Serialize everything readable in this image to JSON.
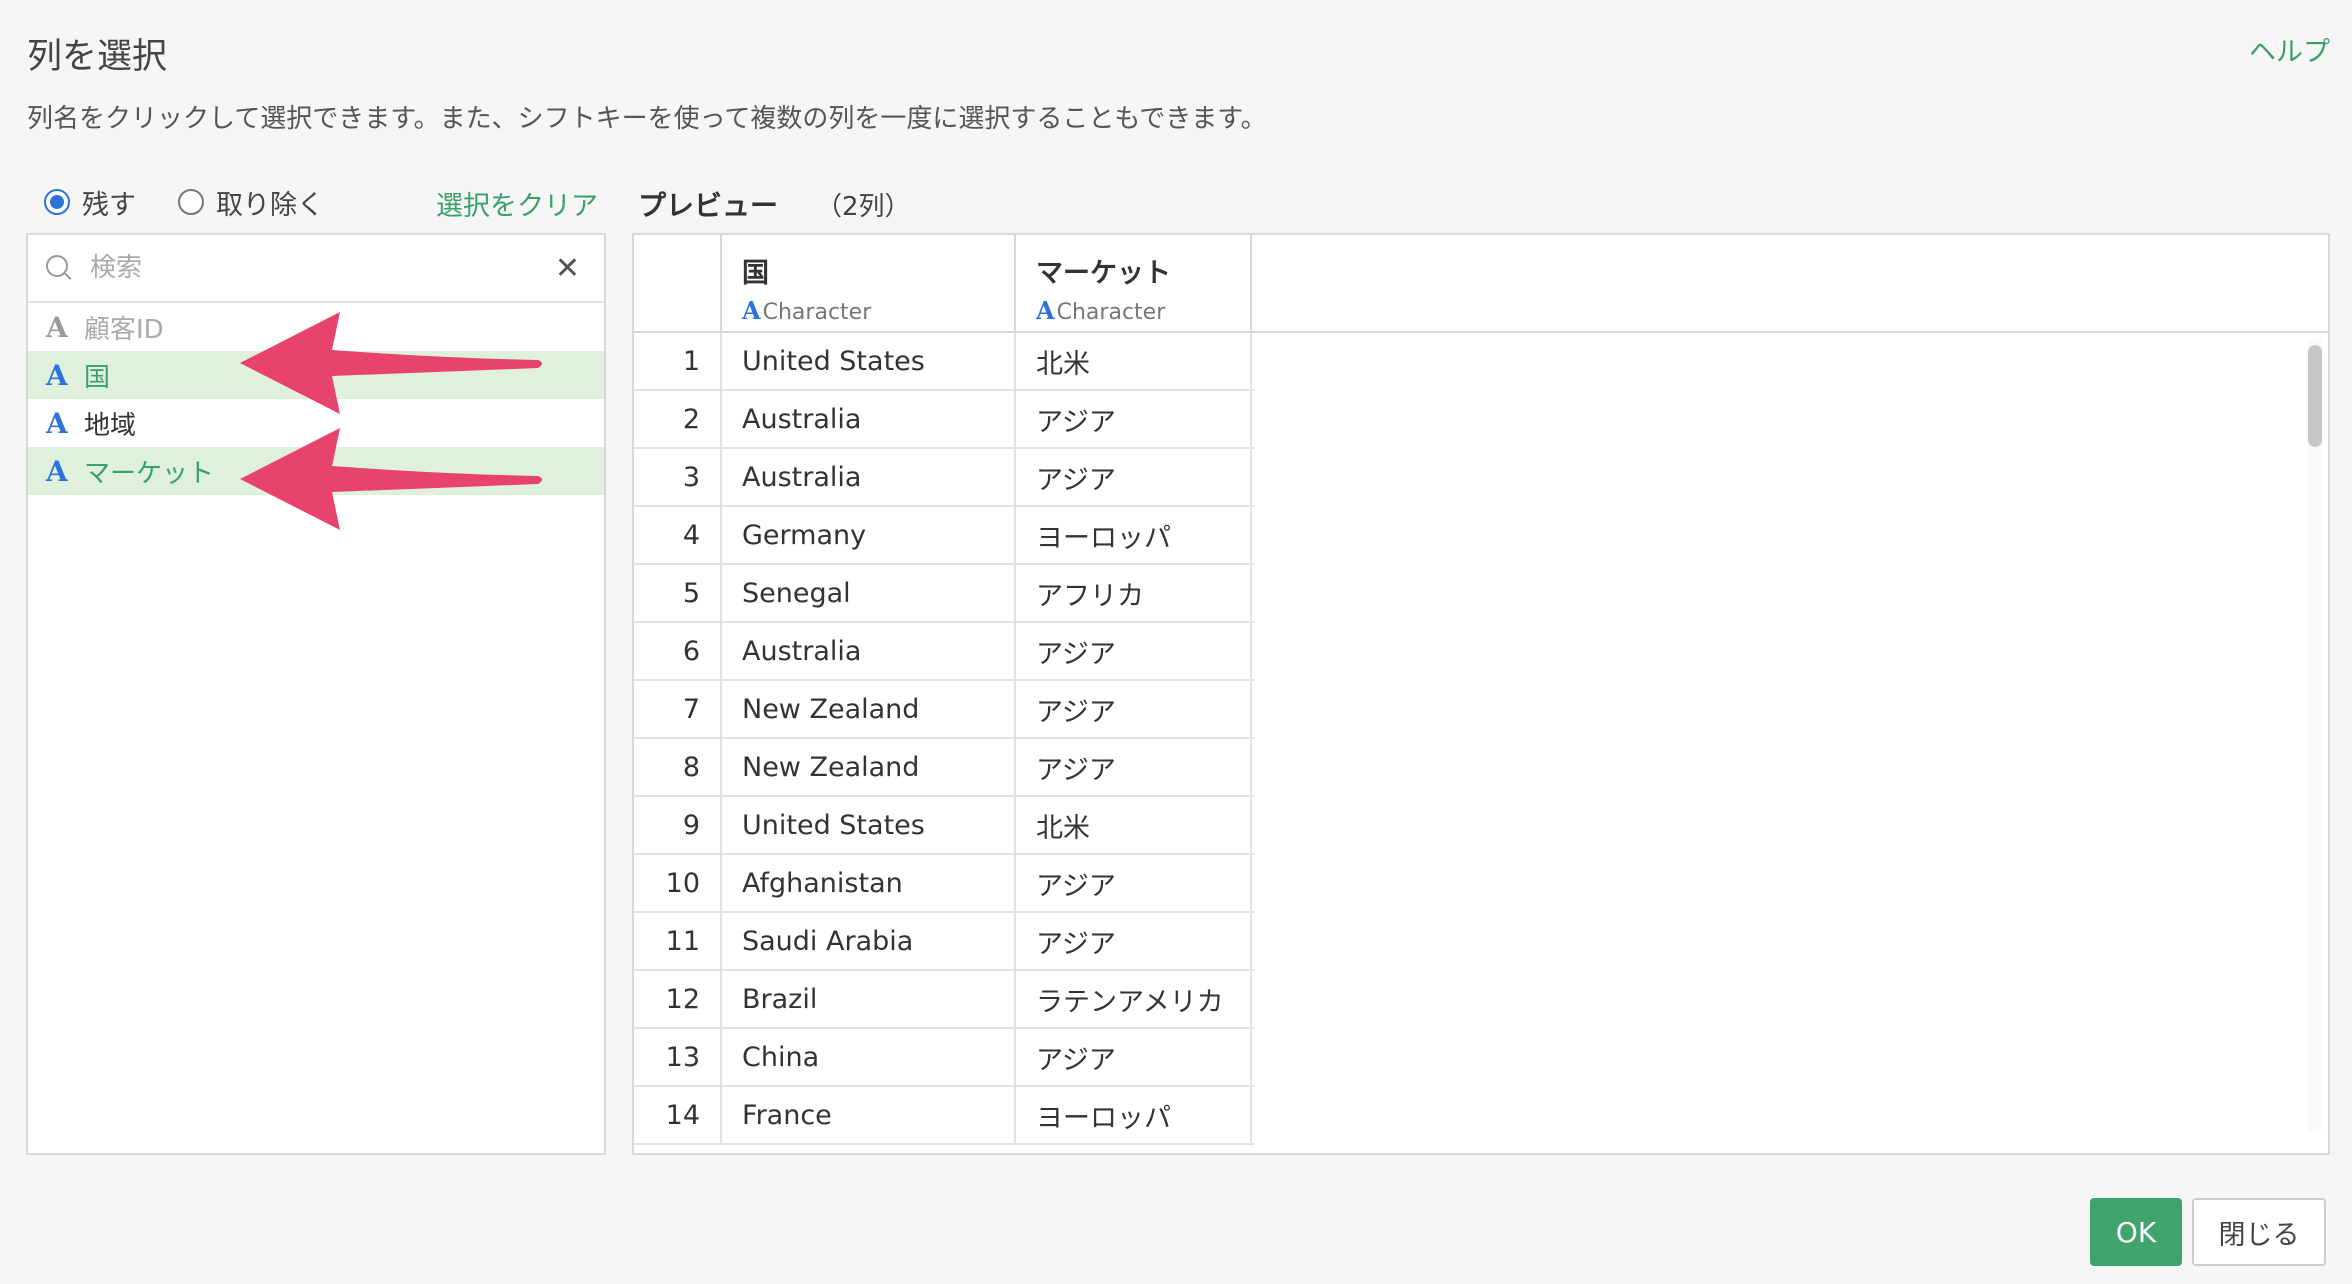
{
  "dialog": {
    "title": "列を選択",
    "help_label": "ヘルプ",
    "description": "列名をクリックして選択できます。また、シフトキーを使って複数の列を一度に選択することもできます。"
  },
  "mode": {
    "keep_label": "残す",
    "remove_label": "取り除く",
    "selected": "keep",
    "clear_label": "選択をクリア"
  },
  "search": {
    "placeholder": "検索",
    "value": ""
  },
  "columns": [
    {
      "label": "顧客ID",
      "type_icon": "A",
      "state": "disabled"
    },
    {
      "label": "国",
      "type_icon": "A",
      "state": "selected"
    },
    {
      "label": "地域",
      "type_icon": "A",
      "state": "normal"
    },
    {
      "label": "マーケット",
      "type_icon": "A",
      "state": "selected"
    }
  ],
  "preview": {
    "title": "プレビュー",
    "count": "（2列）",
    "headers": [
      {
        "name": "国",
        "type_icon": "A",
        "type": "Character"
      },
      {
        "name": "マーケット",
        "type_icon": "A",
        "type": "Character"
      }
    ],
    "rows": [
      [
        "1",
        "United States",
        "北米"
      ],
      [
        "2",
        "Australia",
        "アジア"
      ],
      [
        "3",
        "Australia",
        "アジア"
      ],
      [
        "4",
        "Germany",
        "ヨーロッパ"
      ],
      [
        "5",
        "Senegal",
        "アフリカ"
      ],
      [
        "6",
        "Australia",
        "アジア"
      ],
      [
        "7",
        "New Zealand",
        "アジア"
      ],
      [
        "8",
        "New Zealand",
        "アジア"
      ],
      [
        "9",
        "United States",
        "北米"
      ],
      [
        "10",
        "Afghanistan",
        "アジア"
      ],
      [
        "11",
        "Saudi Arabia",
        "アジア"
      ],
      [
        "12",
        "Brazil",
        "ラテンアメリカ"
      ],
      [
        "13",
        "China",
        "アジア"
      ],
      [
        "14",
        "France",
        "ヨーロッパ"
      ]
    ]
  },
  "buttons": {
    "ok_label": "OK",
    "close_label": "閉じる"
  },
  "colors": {
    "accent_green": "#3aa06a",
    "selected_bg": "#dff0dc",
    "type_icon_blue": "#2f73d8",
    "annotation_arrow": "#e8436d"
  }
}
